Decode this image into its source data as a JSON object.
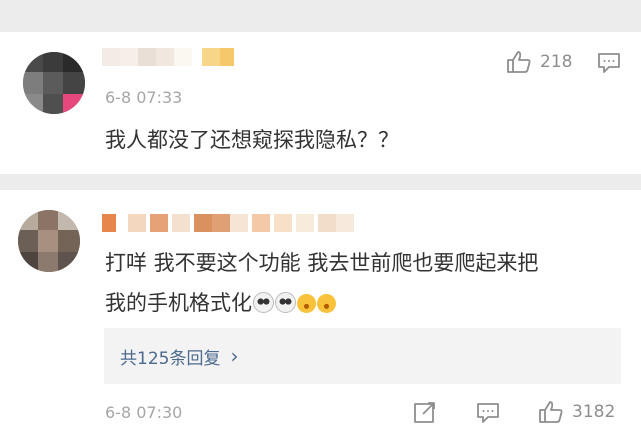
{
  "comments": [
    {
      "time": "6-8 07:33",
      "text": "我人都没了还想窥探我隐私？？",
      "likes": "218",
      "icons": {
        "like": "thumbs-up-icon",
        "reply": "comment-icon"
      }
    },
    {
      "time": "6-8 07:30",
      "text_line1": "打咩 我不要这个功能 我去世前爬也要爬起来把",
      "text_line2": "我的手机格式化",
      "emojis": [
        "panda-face-icon",
        "panda-face-icon",
        "grin-face-icon",
        "grin-face-icon"
      ],
      "replies_label": "共125条回复",
      "replies_chevron": "›",
      "likes": "3182",
      "icons": {
        "share": "share-icon",
        "reply": "comment-icon",
        "like": "thumbs-up-icon"
      }
    }
  ],
  "colors": {
    "link": "#4d6a8f",
    "meta": "#a6a6a6",
    "icon": "#8e8e8e"
  }
}
